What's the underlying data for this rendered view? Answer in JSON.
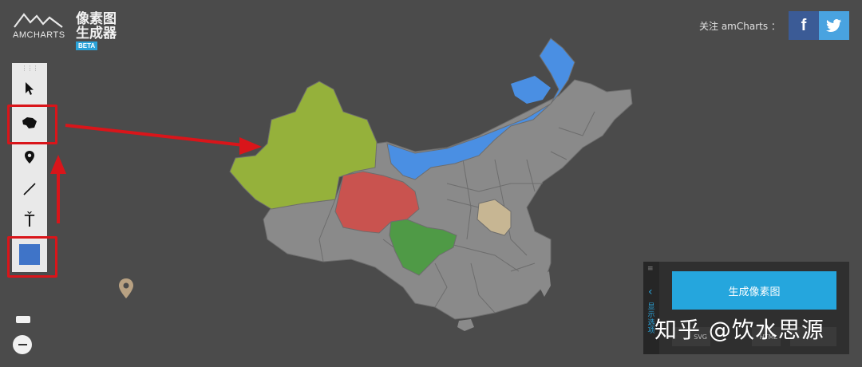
{
  "header": {
    "brand": "AMCHARTS",
    "title_line1": "像素图",
    "title_line2": "生成器",
    "badge": "BETA",
    "follow_label": "关注 amCharts ："
  },
  "social": {
    "facebook_glyph": "f",
    "twitter_icon": "twitter-bird"
  },
  "toolbar": {
    "tools": [
      {
        "id": "select",
        "icon": "pointer-icon"
      },
      {
        "id": "region",
        "icon": "region-fill-icon",
        "highlighted": true
      },
      {
        "id": "marker",
        "icon": "map-pin-icon"
      },
      {
        "id": "line",
        "icon": "line-icon"
      },
      {
        "id": "text",
        "icon": "text-icon",
        "glyph": "Ť"
      },
      {
        "id": "color",
        "icon": "color-swatch-icon",
        "highlighted": true,
        "color": "#3f74c8"
      }
    ]
  },
  "map": {
    "colors": {
      "default": "#8a8a8a",
      "border": "#6d6d6d",
      "inner_mongolia": "#4a8fe3",
      "xinjiang": "#95b13b",
      "qinghai": "#c9534f",
      "sichuan": "#4f9a46",
      "henan": "#c7b693",
      "marker": "#b8a182"
    }
  },
  "annotation": {
    "color": "#d9151a"
  },
  "panel": {
    "side_label": "显示选项",
    "generate_button": "生成像素图",
    "format_svg": "SVG",
    "format_html": "HTML"
  },
  "watermark": "知乎 @饮水思源"
}
